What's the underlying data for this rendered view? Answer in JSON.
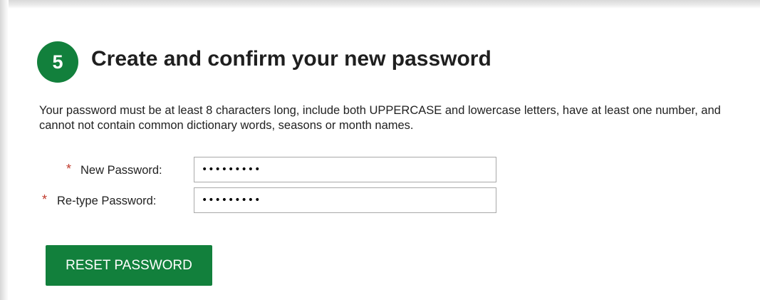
{
  "step": {
    "number": "5",
    "title": "Create and confirm your new password"
  },
  "instructions": "Your password must be at least 8 characters long, include both UPPERCASE and lowercase letters, have at least one number, and cannot not contain common dictionary words, seasons or month names.",
  "form": {
    "new_password": {
      "required_marker": "*",
      "label": "New Password:",
      "value": "•••••••••"
    },
    "retype_password": {
      "required_marker": "*",
      "label": "Re-type Password:",
      "value": "•••••••••"
    },
    "submit_label": "RESET PASSWORD"
  },
  "colors": {
    "accent_green": "#12803c",
    "required_red": "#c0392b"
  }
}
